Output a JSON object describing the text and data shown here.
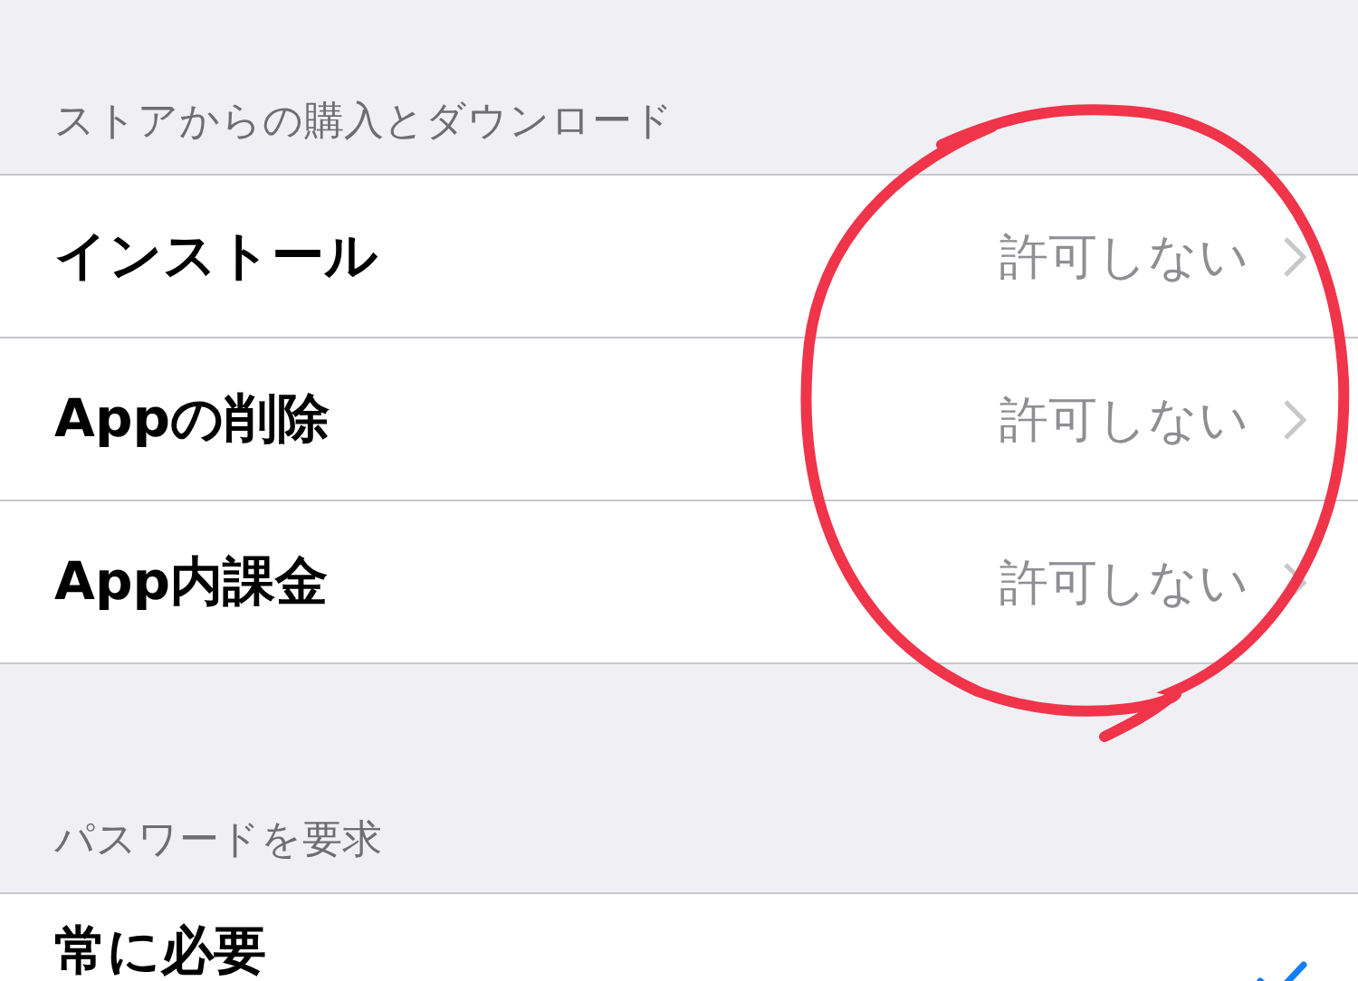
{
  "sections": [
    {
      "header": "ストアからの購入とダウンロード",
      "rows": [
        {
          "kind": "disclosure",
          "label": "インストール",
          "value": "許可しない"
        },
        {
          "kind": "disclosure",
          "label": "Appの削除",
          "value": "許可しない"
        },
        {
          "kind": "disclosure",
          "label": "App内課金",
          "value": "許可しない"
        }
      ]
    },
    {
      "header": "パスワードを要求",
      "rows": [
        {
          "kind": "option",
          "label": "常に必要",
          "selected": true
        }
      ]
    }
  ]
}
